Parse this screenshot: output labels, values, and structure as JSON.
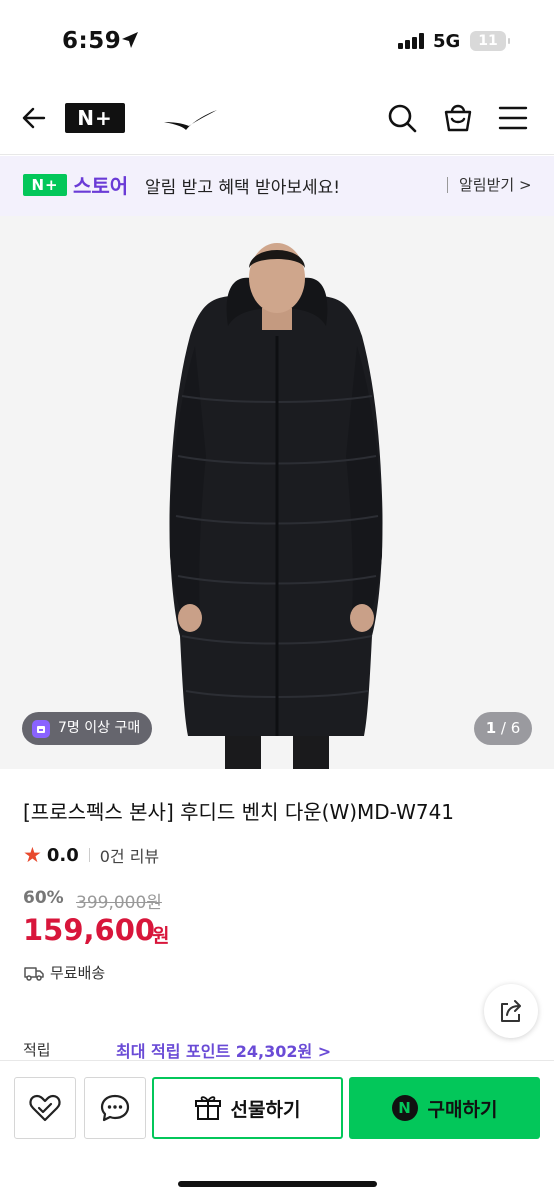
{
  "status_bar": {
    "time": "6:59",
    "network": "5G",
    "battery": "11"
  },
  "header": {
    "logo_text": "N+",
    "icons": [
      "back-arrow-icon",
      "n-plus-logo",
      "brand-swoosh-logo",
      "search-icon",
      "shopping-bag-icon",
      "hamburger-menu-icon"
    ]
  },
  "banner": {
    "badge": "N+",
    "store_name": "스토어",
    "message": "알림 받고 혜택 받아보세요!",
    "action": "알림받기 >"
  },
  "gallery": {
    "buyers_badge": "7명 이상 구매",
    "current_page": "1",
    "total_pages": "/ 6"
  },
  "product": {
    "title": "[프로스펙스 본사] 후디드 벤치 다운(W)MD-W741",
    "rating": "0.0",
    "review_count": "0건 리뷰",
    "discount": "60%",
    "original_price": "399,000원",
    "price": "159,600",
    "currency": "원",
    "shipping": "무료배송",
    "points_label": "적립",
    "points_value": "최대 적립 포인트 24,302원 >"
  },
  "bottom_bar": {
    "gift_label": "선물하기",
    "buy_label": "구매하기",
    "buy_badge": "N"
  },
  "colors": {
    "naver_green": "#03c75a",
    "price_red": "#d8163b",
    "purple": "#6a3bd6"
  }
}
